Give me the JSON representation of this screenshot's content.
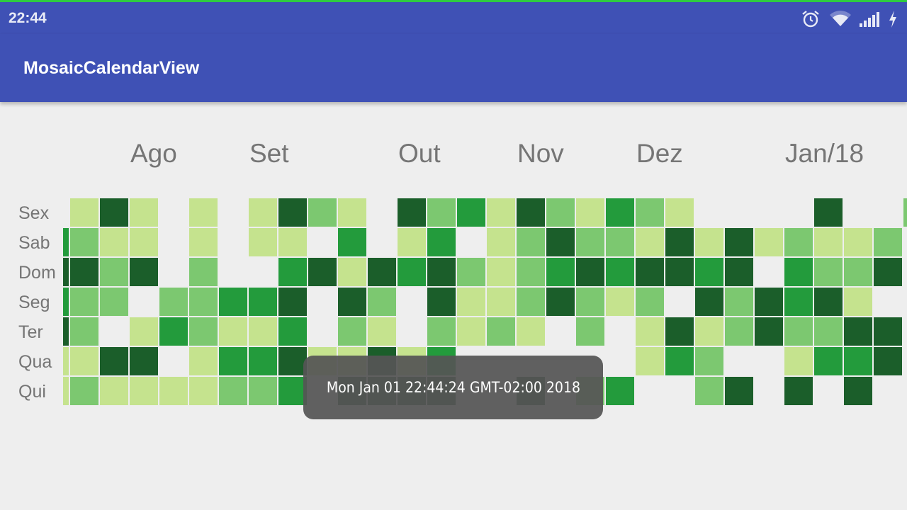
{
  "status_bar": {
    "time": "22:44",
    "icons": [
      "alarm-icon",
      "wifi-icon",
      "signal-icon",
      "charging-icon"
    ]
  },
  "app_bar": {
    "title": "MosaicCalendarView"
  },
  "colors": {
    "app_bar": "#3f51b5",
    "level_0": "#eeeeee",
    "level_1": "#c5e38e",
    "level_2": "#7cc870",
    "level_3": "#239b3c",
    "level_4": "#1b5e2a"
  },
  "calendar": {
    "months": [
      {
        "label": "Ago",
        "col": 2.3
      },
      {
        "label": "Set",
        "col": 6.3
      },
      {
        "label": "Out",
        "col": 11.3
      },
      {
        "label": "Nov",
        "col": 15.4
      },
      {
        "label": "Dez",
        "col": 19.4
      },
      {
        "label": "Jan/18",
        "col": 24.8
      }
    ],
    "days": [
      "Sex",
      "Sab",
      "Dom",
      "Seg",
      "Ter",
      "Qua",
      "Qui"
    ],
    "levels": [
      [
        0,
        1,
        4,
        1,
        0,
        1,
        0,
        1,
        4,
        2,
        1,
        0,
        4,
        2,
        3,
        1,
        4,
        2,
        1,
        3,
        2,
        1,
        0,
        0,
        0,
        0,
        4,
        0,
        0,
        2
      ],
      [
        3,
        2,
        1,
        1,
        0,
        1,
        0,
        1,
        1,
        0,
        3,
        0,
        1,
        3,
        0,
        1,
        2,
        4,
        2,
        2,
        1,
        4,
        1,
        4,
        1,
        2,
        1,
        1,
        2,
        0
      ],
      [
        4,
        4,
        2,
        4,
        0,
        2,
        0,
        0,
        3,
        4,
        1,
        4,
        3,
        4,
        2,
        1,
        2,
        3,
        4,
        3,
        4,
        4,
        3,
        4,
        0,
        3,
        2,
        2,
        4,
        0
      ],
      [
        3,
        2,
        2,
        0,
        2,
        2,
        3,
        3,
        4,
        0,
        4,
        2,
        0,
        4,
        1,
        1,
        2,
        4,
        2,
        1,
        2,
        0,
        4,
        2,
        4,
        3,
        4,
        1,
        0,
        0
      ],
      [
        4,
        2,
        0,
        1,
        3,
        2,
        1,
        1,
        3,
        0,
        2,
        1,
        0,
        2,
        1,
        2,
        1,
        0,
        2,
        0,
        1,
        4,
        1,
        2,
        4,
        2,
        2,
        4,
        4,
        0
      ],
      [
        1,
        1,
        4,
        4,
        0,
        1,
        3,
        3,
        4,
        1,
        1,
        4,
        1,
        3,
        0,
        0,
        0,
        0,
        0,
        0,
        1,
        3,
        2,
        0,
        0,
        1,
        3,
        3,
        4,
        0
      ],
      [
        1,
        2,
        1,
        1,
        1,
        1,
        2,
        2,
        3,
        0,
        4,
        4,
        4,
        4,
        0,
        0,
        4,
        0,
        2,
        3,
        0,
        0,
        2,
        4,
        0,
        4,
        0,
        4,
        0,
        0
      ]
    ]
  },
  "toast": {
    "text": "Mon Jan 01 22:44:24 GMT-02:00 2018"
  }
}
